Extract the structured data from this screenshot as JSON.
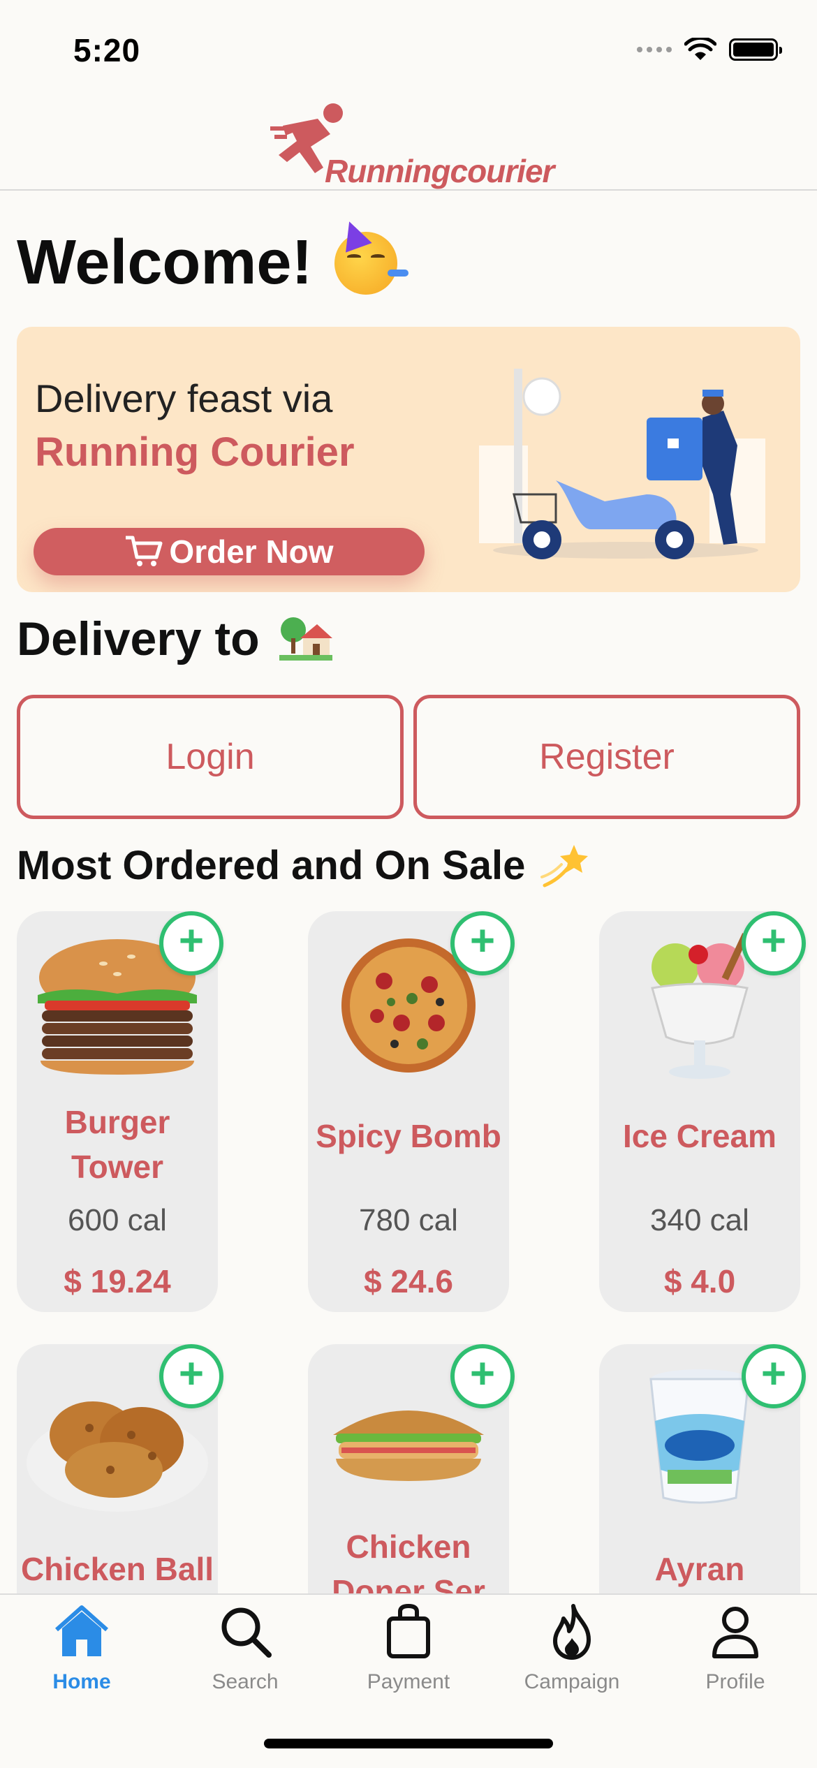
{
  "status_bar": {
    "time": "5:20"
  },
  "header": {
    "logo_text": "Runningcourier"
  },
  "welcome": {
    "title": "Welcome!"
  },
  "banner": {
    "line1": "Delivery feast via",
    "line2": "Running Courier",
    "order_button": "Order Now"
  },
  "delivery": {
    "title": "Delivery to"
  },
  "auth": {
    "login": "Login",
    "register": "Register"
  },
  "section": {
    "title": "Most Ordered and On Sale"
  },
  "products": [
    {
      "name": "Burger Tower",
      "calories": "600 cal",
      "price": "$ 19.24"
    },
    {
      "name": "Spicy Bomb",
      "calories": "780 cal",
      "price": "$ 24.6"
    },
    {
      "name": "Ice Cream",
      "calories": "340 cal",
      "price": "$ 4.0"
    },
    {
      "name": "Chicken Ball",
      "calories": "",
      "price": ""
    },
    {
      "name": "Chicken Doner Ser",
      "calories": "",
      "price": ""
    },
    {
      "name": "Ayran",
      "calories": "",
      "price": ""
    }
  ],
  "tabs": [
    {
      "label": "Home",
      "icon": "home-icon",
      "active": true
    },
    {
      "label": "Search",
      "icon": "search-icon",
      "active": false
    },
    {
      "label": "Payment",
      "icon": "bag-icon",
      "active": false
    },
    {
      "label": "Campaign",
      "icon": "flame-icon",
      "active": false
    },
    {
      "label": "Profile",
      "icon": "person-icon",
      "active": false
    }
  ],
  "colors": {
    "accent": "#cd5a5e",
    "banner": "#fde6c7",
    "add": "#2fbf71",
    "tab_active": "#2b8ce6"
  }
}
